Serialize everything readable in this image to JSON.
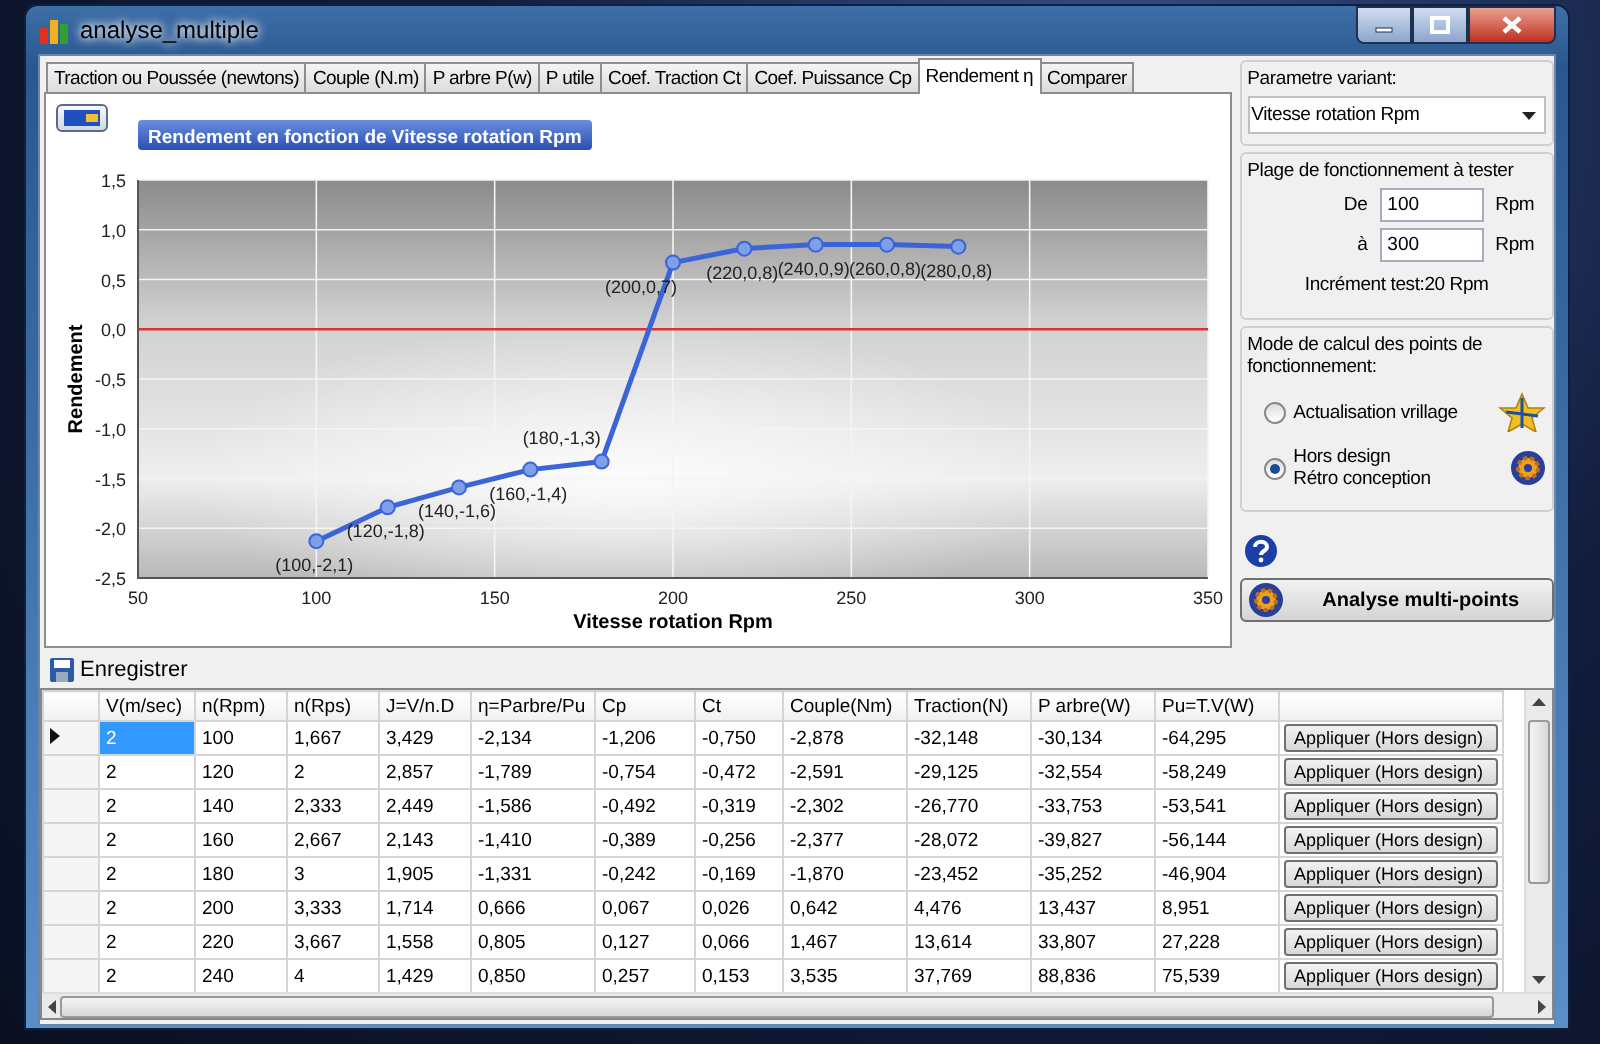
{
  "window": {
    "title": "analyse_multiple"
  },
  "tabs": [
    {
      "label": "Traction ou Poussée (newtons)",
      "selected": false
    },
    {
      "label": "Couple (N.m)",
      "selected": false
    },
    {
      "label": "P arbre P(w)",
      "selected": false
    },
    {
      "label": "P utile",
      "selected": false
    },
    {
      "label": "Coef. Traction Ct",
      "selected": false
    },
    {
      "label": "Coef. Puissance Cp",
      "selected": false
    },
    {
      "label": "Rendement η",
      "selected": true
    },
    {
      "label": "Comparer",
      "selected": false
    }
  ],
  "chart": {
    "chart_data": {
      "type": "line",
      "title": "Rendement en fonction de Vitesse rotation Rpm",
      "xlabel": "Vitesse rotation Rpm",
      "ylabel": "Rendement",
      "x": [
        100,
        120,
        140,
        160,
        180,
        200,
        220,
        240,
        260,
        280
      ],
      "series": [
        {
          "color": "#3a64d8",
          "marker": "circle",
          "values": [
            -2.13,
            -1.79,
            -1.59,
            -1.41,
            -1.33,
            0.67,
            0.81,
            0.85,
            0.85,
            0.83
          ]
        }
      ],
      "grid": true,
      "value_labels": [
        "(100,-2,1)",
        "(120,-1,8)",
        "(140,-1,6)",
        "(160,-1,4)",
        "(180,-1,3)",
        "(200,0,7)",
        "(220,0,8)",
        "(240,0,9)",
        "(260,0,8)",
        "(280,0,8)"
      ],
      "xlim": [
        50,
        350
      ],
      "ylim": [
        -2.5,
        1.5
      ],
      "xticks": [
        {
          "value": 50,
          "label": "50"
        },
        {
          "value": 100,
          "label": "100"
        },
        {
          "value": 150,
          "label": "150"
        },
        {
          "value": 200,
          "label": "200"
        },
        {
          "value": 250,
          "label": "250"
        },
        {
          "value": 300,
          "label": "300"
        },
        {
          "value": 350,
          "label": "350"
        }
      ],
      "yticks": [
        {
          "value": -2.5,
          "label": "-2,5"
        },
        {
          "value": -2,
          "label": "-2,0"
        },
        {
          "value": -1.5,
          "label": "-1,5"
        },
        {
          "value": -1,
          "label": "-1,0"
        },
        {
          "value": -0.5,
          "label": "-0,5"
        },
        {
          "value": 0,
          "label": "0,0"
        },
        {
          "value": 0.5,
          "label": "0,5"
        },
        {
          "value": 1,
          "label": "1,0"
        },
        {
          "value": 1.5,
          "label": "1,5"
        }
      ],
      "ref_lines": [
        {
          "axis": "y",
          "value": 0,
          "color": "#e03030"
        }
      ]
    }
  },
  "side_panel": {
    "parameter_label": "Parametre variant:",
    "parameter_value": "Vitesse rotation Rpm",
    "range_title": "Plage de fonctionnement à tester",
    "range_rows": [
      {
        "label": "De",
        "value": "100",
        "unit": "Rpm"
      },
      {
        "label": "à",
        "value": "300",
        "unit": "Rpm"
      }
    ],
    "increment": "Incrément test:20 Rpm",
    "mode_title": "Mode de calcul des points de fonctionnement:",
    "modes": [
      {
        "label": "Actualisation vrillage",
        "selected": false,
        "kind": "star"
      },
      {
        "label": "Hors design\nRétro conception",
        "selected": true,
        "kind": "gear"
      }
    ],
    "run_button": "Analyse multi-points"
  },
  "toolbar": {
    "save_button": "Enregistrer"
  },
  "table": {
    "columns": [
      "V(m/sec)",
      "n(Rpm)",
      "n(Rps)",
      "J=V/n.D",
      "η=Parbre/Pu",
      "Cp",
      "Ct",
      "Couple(Nm)",
      "Traction(N)",
      "P arbre(W)",
      "Pu=T.V(W)"
    ],
    "rows": [
      {
        "selected": true,
        "cells": [
          "2",
          "100",
          "1,667",
          "3,429",
          "-2,134",
          "-1,206",
          "-0,750",
          "-2,878",
          "-32,148",
          "-30,134",
          "-64,295"
        ],
        "action": "Appliquer (Hors design)"
      },
      {
        "selected": false,
        "cells": [
          "2",
          "120",
          "2",
          "2,857",
          "-1,789",
          "-0,754",
          "-0,472",
          "-2,591",
          "-29,125",
          "-32,554",
          "-58,249"
        ],
        "action": "Appliquer (Hors design)"
      },
      {
        "selected": false,
        "cells": [
          "2",
          "140",
          "2,333",
          "2,449",
          "-1,586",
          "-0,492",
          "-0,319",
          "-2,302",
          "-26,770",
          "-33,753",
          "-53,541"
        ],
        "action": "Appliquer (Hors design)"
      },
      {
        "selected": false,
        "cells": [
          "2",
          "160",
          "2,667",
          "2,143",
          "-1,410",
          "-0,389",
          "-0,256",
          "-2,377",
          "-28,072",
          "-39,827",
          "-56,144"
        ],
        "action": "Appliquer (Hors design)"
      },
      {
        "selected": false,
        "cells": [
          "2",
          "180",
          "3",
          "1,905",
          "-1,331",
          "-0,242",
          "-0,169",
          "-1,870",
          "-23,452",
          "-35,252",
          "-46,904"
        ],
        "action": "Appliquer (Hors design)"
      },
      {
        "selected": false,
        "cells": [
          "2",
          "200",
          "3,333",
          "1,714",
          "0,666",
          "0,067",
          "0,026",
          "0,642",
          "4,476",
          "13,437",
          "8,951"
        ],
        "action": "Appliquer (Hors design)"
      },
      {
        "selected": false,
        "cells": [
          "2",
          "220",
          "3,667",
          "1,558",
          "0,805",
          "0,127",
          "0,066",
          "1,467",
          "13,614",
          "33,807",
          "27,228"
        ],
        "action": "Appliquer (Hors design)"
      },
      {
        "selected": false,
        "cells": [
          "2",
          "240",
          "4",
          "1,429",
          "0,850",
          "0,257",
          "0,153",
          "3,535",
          "37,769",
          "88,836",
          "75,539"
        ],
        "action": "Appliquer (Hors design)"
      }
    ]
  }
}
